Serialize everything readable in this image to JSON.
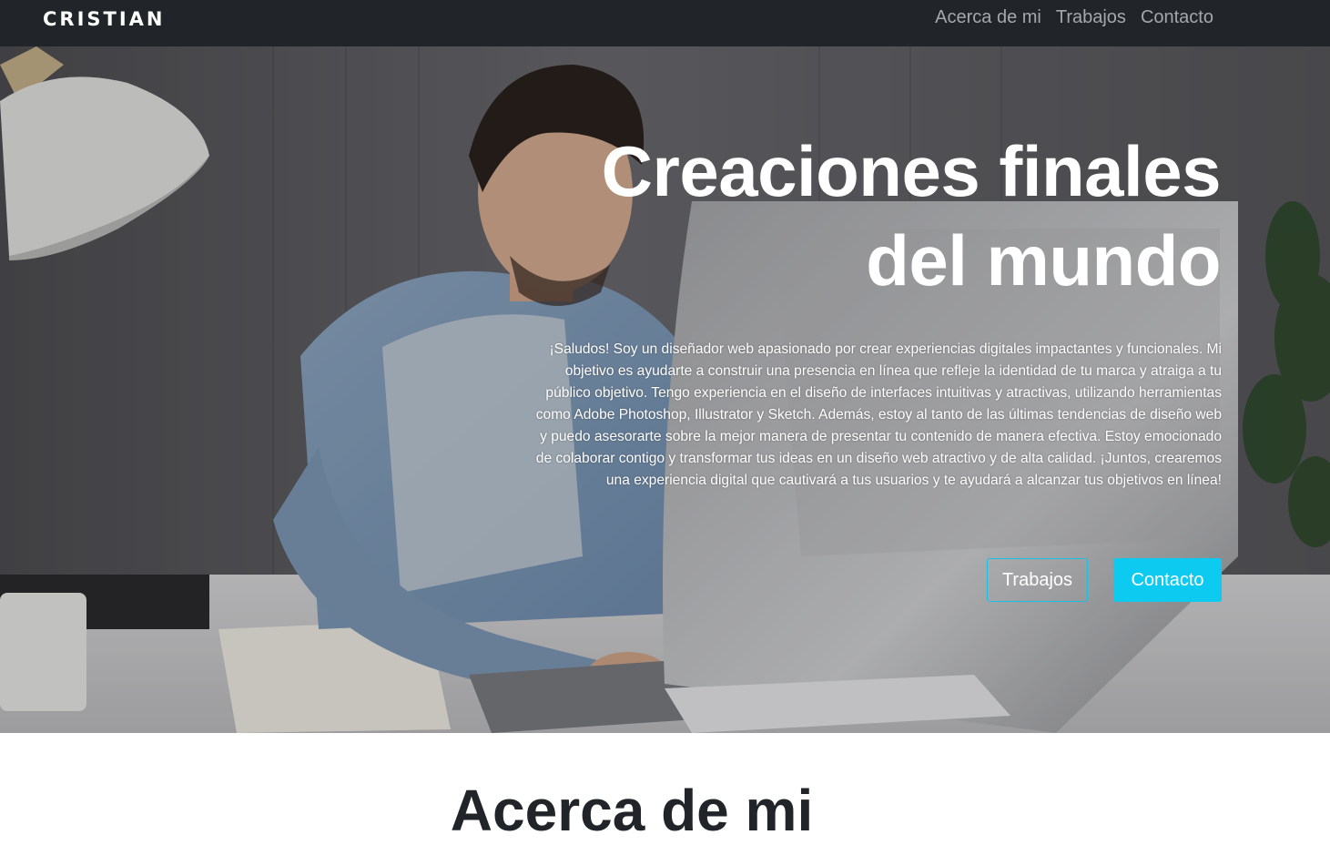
{
  "navbar": {
    "brand": "CRISTIAN",
    "links": [
      "Acerca de mi",
      "Trabajos",
      "Contacto"
    ]
  },
  "hero": {
    "title_line1": "Creaciones finales",
    "title_line2": "del mundo",
    "description": "¡Saludos! Soy un diseñador web apasionado por crear experiencias digitales impactantes y funcionales. Mi objetivo es ayudarte a construir una presencia en línea que refleje la identidad de tu marca y atraiga a tu público objetivo. Tengo experiencia en el diseño de interfaces intuitivas y atractivas, utilizando herramientas como Adobe Photoshop, Illustrator y Sketch. Además, estoy al tanto de las últimas tendencias de diseño web y puedo asesorarte sobre la mejor manera de presentar tu contenido de manera efectiva. Estoy emocionado de colaborar contigo y transformar tus ideas en un diseño web atractivo y de alta calidad. ¡Juntos, crearemos una experiencia digital que cautivará a tus usuarios y te ayudará a alcanzar tus objetivos en línea!",
    "buttons": {
      "works": "Trabajos",
      "contact": "Contacto"
    }
  },
  "about": {
    "title": "Acerca de mi"
  },
  "colors": {
    "navbar_bg": "#212529",
    "accent": "#0dcaf0",
    "text_dark": "#212529"
  }
}
